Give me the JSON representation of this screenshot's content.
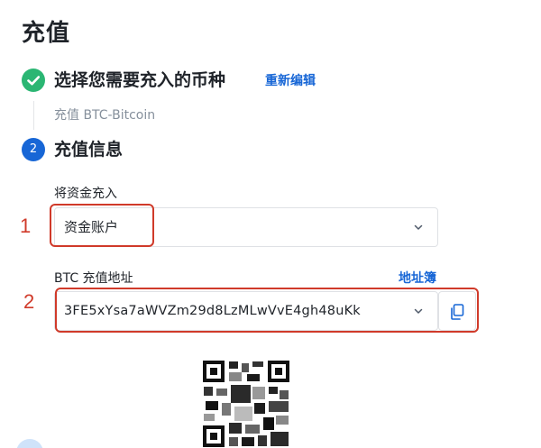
{
  "page": {
    "title": "充值"
  },
  "step1": {
    "title": "选择您需要充入的币种",
    "edit_link": "重新编辑",
    "summary": "充值 BTC-Bitcoin",
    "status_icon": "check-icon",
    "status_color": "#2bb673"
  },
  "step2": {
    "number": "2",
    "title": "充值信息",
    "accent_color": "#1766d6"
  },
  "fund_field": {
    "label": "将资金充入",
    "value": "资金账户"
  },
  "address_field": {
    "label": "BTC 充值地址",
    "address_book_link": "地址簿",
    "value": "3FE5xYsa7aWVZm29d8LzMLwVvE4gh48uKk",
    "copy_icon": "copy-icon"
  },
  "annotations": {
    "one": "1",
    "two": "2",
    "color": "#d03a2a"
  },
  "qr_code": {
    "icon": "qr-code",
    "blurred": true
  }
}
